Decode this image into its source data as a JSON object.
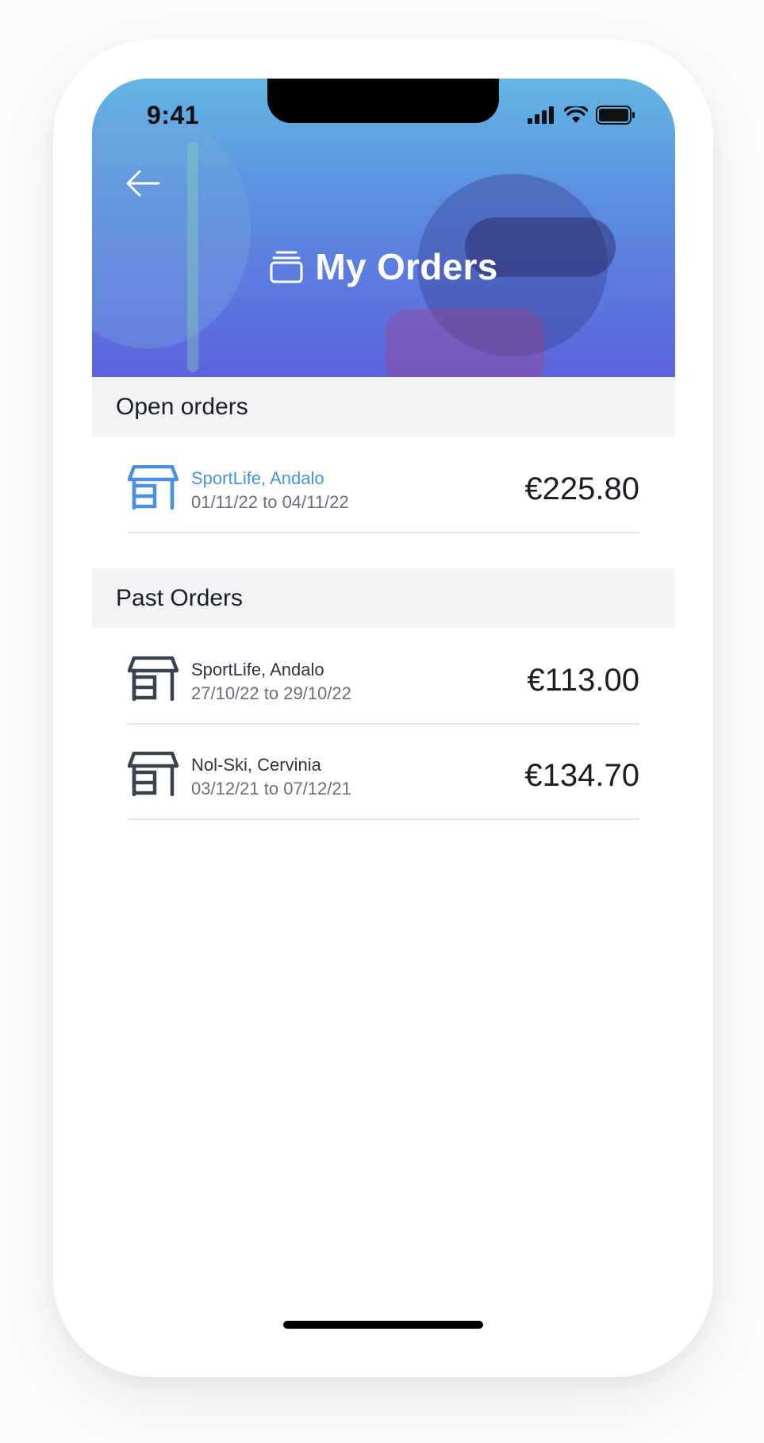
{
  "status_bar": {
    "time": "9:41"
  },
  "header": {
    "title": "My Orders",
    "back_icon": "arrow-left-icon",
    "title_icon": "orders-stack-icon"
  },
  "sections": {
    "open": {
      "heading": "Open orders",
      "orders": [
        {
          "store": "SportLife, Andalo",
          "dates": "01/11/22 to 04/11/22",
          "price": "€225.80",
          "icon": "store-icon",
          "accent": "#4a90e2"
        }
      ]
    },
    "past": {
      "heading": "Past Orders",
      "orders": [
        {
          "store": "SportLife, Andalo",
          "dates": "27/10/22 to 29/10/22",
          "price": "€113.00",
          "icon": "store-icon"
        },
        {
          "store": "Nol-Ski, Cervinia",
          "dates": "03/12/21 to 07/12/21",
          "price": "€134.70",
          "icon": "store-icon"
        }
      ]
    }
  },
  "colors": {
    "header_top": "#63b6e4",
    "header_bottom": "#5d63de",
    "accent": "#4a90e2",
    "icon_dark": "#3a4150"
  }
}
